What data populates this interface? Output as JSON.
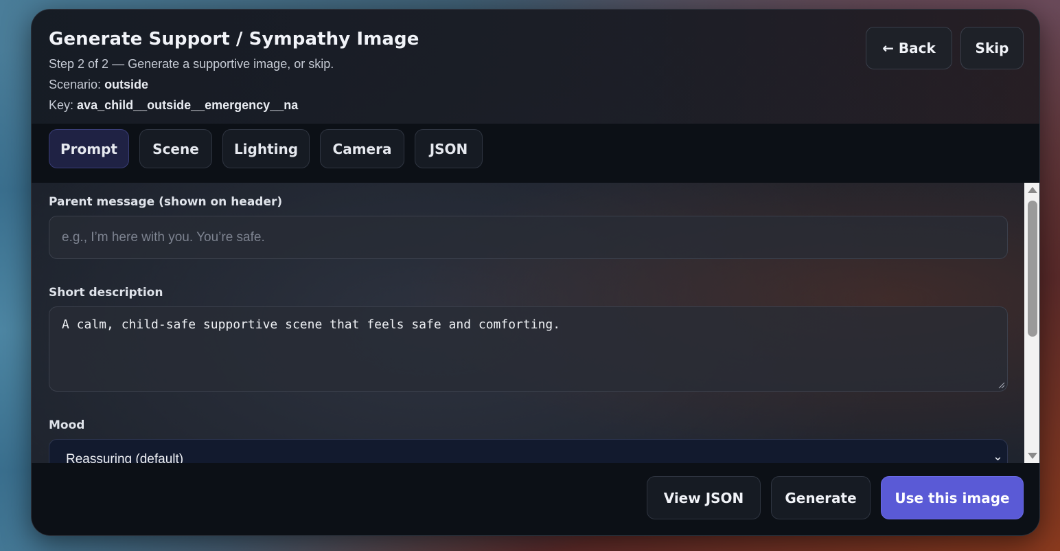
{
  "header": {
    "title": "Generate Support / Sympathy Image",
    "step_text": "Step 2 of 2 — Generate a supportive image, or skip.",
    "scenario_label": "Scenario:",
    "scenario_value": "outside",
    "key_label": "Key:",
    "key_value": "ava_child__outside__emergency__na",
    "back_label": "← Back",
    "skip_label": "Skip"
  },
  "tabs": [
    {
      "label": "Prompt",
      "active": true
    },
    {
      "label": "Scene",
      "active": false
    },
    {
      "label": "Lighting",
      "active": false
    },
    {
      "label": "Camera",
      "active": false
    },
    {
      "label": "JSON",
      "active": false
    }
  ],
  "form": {
    "parent_message": {
      "label": "Parent message (shown on header)",
      "value": "",
      "placeholder": "e.g., I’m here with you. You’re safe."
    },
    "short_description": {
      "label": "Short description",
      "value": "A calm, child-safe supportive scene that feels safe and comforting."
    },
    "mood": {
      "label": "Mood",
      "selected": "Reassuring (default)"
    }
  },
  "footer": {
    "view_json_label": "View JSON",
    "generate_label": "Generate",
    "use_image_label": "Use this image"
  },
  "colors": {
    "accent": "#5a5ad6",
    "active_tab": "#1f2244"
  }
}
